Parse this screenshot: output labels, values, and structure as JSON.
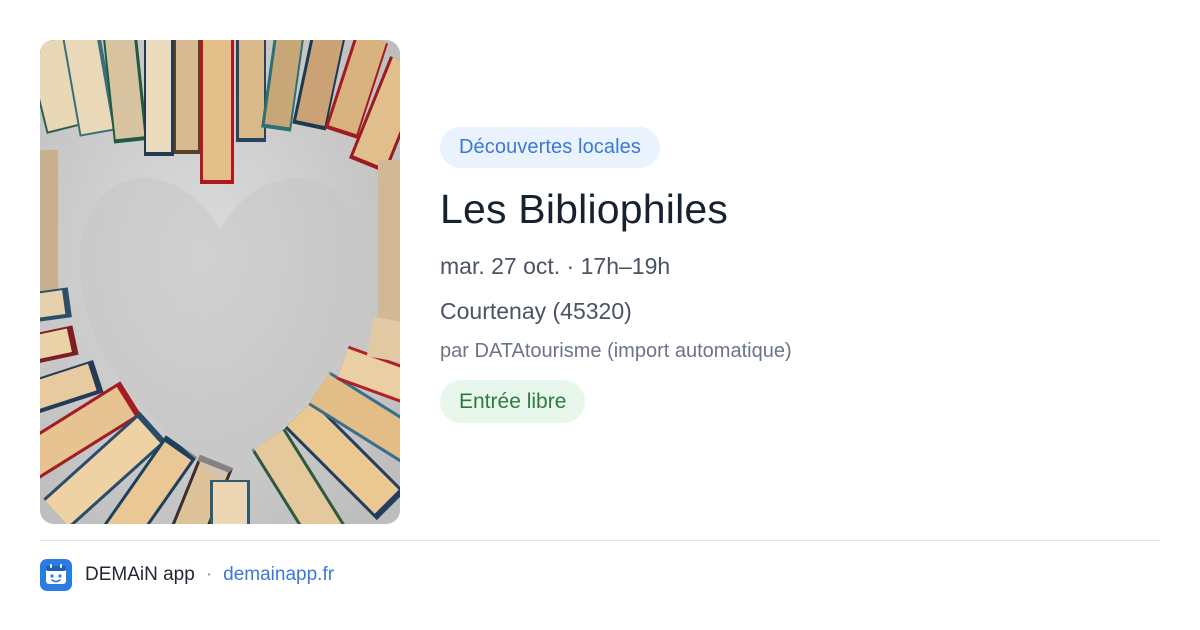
{
  "event": {
    "image_subject": "books-heart-photo",
    "category": "Découvertes locales",
    "title": "Les Bibliophiles",
    "date_time": "mar. 27 oct. · 17h–19h",
    "location": "Courtenay (45320)",
    "source": "par DATAtourisme (import automatique)",
    "price": "Entrée libre"
  },
  "footer": {
    "app_icon": "demain-app-icon",
    "app_name": "DEMAiN app",
    "separator": "·",
    "link": "demainapp.fr"
  },
  "colors": {
    "accent": "#3b78d8",
    "category_bg": "#eaf2fd",
    "price_text": "#2f7a3f",
    "price_bg": "#e8f7ec",
    "title": "#17212f"
  }
}
